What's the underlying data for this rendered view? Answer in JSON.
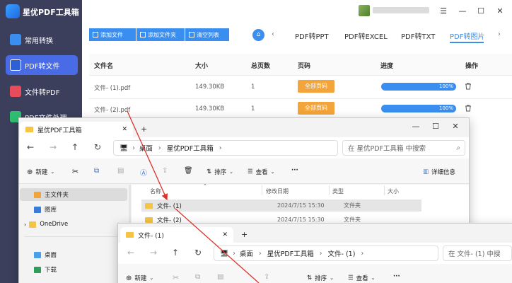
{
  "app": {
    "title": "星优PDF工具箱",
    "sidebar": [
      "常用转换",
      "PDF转文件",
      "文件转PDF",
      "PDF文件处理"
    ],
    "window_controls": [
      "☰",
      "—",
      "☐",
      "✕"
    ],
    "toolbar": {
      "add_file": "添加文件",
      "add_folder": "添加文件夹",
      "clear_list": "清空列表"
    },
    "tabs": [
      "PDF转PPT",
      "PDF转EXCEL",
      "PDF转TXT",
      "PDF转图片"
    ],
    "active_tab": 3,
    "table": {
      "headers": [
        "文件名",
        "大小",
        "总页数",
        "页码",
        "进度",
        "操作"
      ],
      "rows": [
        {
          "name": "文件- (1).pdf",
          "size": "149.30KB",
          "pages": "1",
          "page_btn": "全部页码",
          "progress": "100%"
        },
        {
          "name": "文件- (2).pdf",
          "size": "149.30KB",
          "pages": "1",
          "page_btn": "全部页码",
          "progress": "100%"
        }
      ]
    }
  },
  "explorer1": {
    "tab_title": "星优PDF工具箱",
    "window_controls": [
      "—",
      "☐",
      "✕"
    ],
    "breadcrumb": [
      "桌面",
      "星优PDF工具箱"
    ],
    "search_placeholder": "在 星优PDF工具箱 中搜索",
    "commands": {
      "new": "新建",
      "sort": "排序",
      "view": "查看",
      "more": "···",
      "details": "详细信息"
    },
    "nav": [
      "主文件夹",
      "图库",
      "OneDrive",
      "桌面",
      "下载"
    ],
    "columns": [
      "名称",
      "修改日期",
      "类型",
      "大小"
    ],
    "files": [
      {
        "name": "文件- (1)",
        "date": "2024/7/15 15:30",
        "type": "文件夹"
      },
      {
        "name": "文件- (2)",
        "date": "2024/7/15 15:30",
        "type": "文件夹"
      }
    ]
  },
  "explorer2": {
    "tab_title": "文件- (1)",
    "breadcrumb": [
      "桌面",
      "星优PDF工具箱",
      "文件- (1)"
    ],
    "search_placeholder": "在 文件- (1) 中搜",
    "commands": {
      "new": "新建",
      "sort": "排序",
      "view": "查看",
      "more": "···"
    }
  },
  "colors": {
    "accent": "#3a8ef0",
    "sidebar": "#3b3f5c",
    "page_button": "#f3a43a",
    "annotation": "#d9342b"
  }
}
